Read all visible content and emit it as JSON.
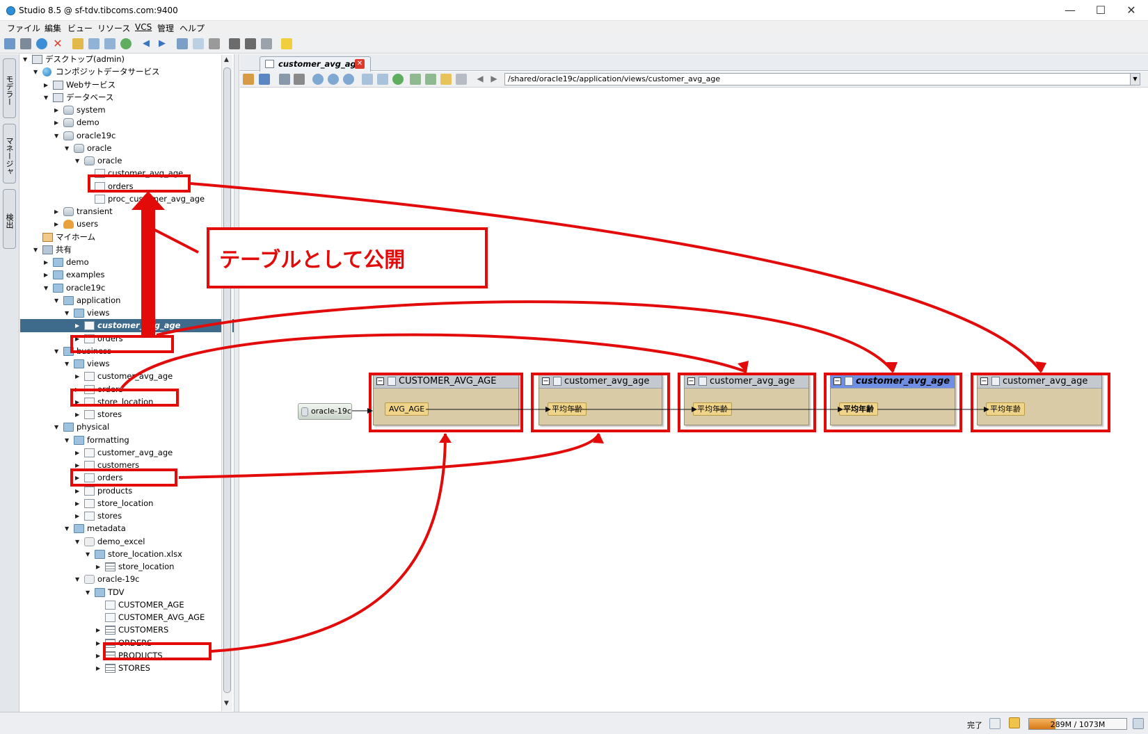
{
  "window": {
    "title": "Studio 8.5 @ sf-tdv.tibcoms.com:9400",
    "minimize": "—",
    "maximize": "☐",
    "close": "✕"
  },
  "menu": [
    "ファイル",
    "編集",
    "ビュー",
    "リソース",
    "VCS",
    "管理",
    "ヘルプ"
  ],
  "side_tabs": [
    "モデラー",
    "マネージャ",
    "検出"
  ],
  "tree": [
    {
      "label": "デスクトップ(admin)",
      "icon": "computer",
      "twisty": "▼"
    },
    {
      "label": "コンポジットデータサービス",
      "icon": "globe",
      "twisty": "▼"
    },
    {
      "label": "Webサービス",
      "icon": "composite",
      "twisty": "▶"
    },
    {
      "label": "データベース",
      "icon": "composite",
      "twisty": "▼"
    },
    {
      "label": "system",
      "icon": "db",
      "twisty": "▶"
    },
    {
      "label": "demo",
      "icon": "db",
      "twisty": "▶"
    },
    {
      "label": "oracle19c",
      "icon": "db",
      "twisty": "▼"
    },
    {
      "label": "oracle",
      "icon": "db",
      "twisty": "▼"
    },
    {
      "label": "oracle",
      "icon": "db",
      "twisty": "▼"
    },
    {
      "label": "customer_avg_age",
      "icon": "view",
      "twisty": ""
    },
    {
      "label": "orders",
      "icon": "view",
      "twisty": ""
    },
    {
      "label": "proc_customer_avg_age",
      "icon": "view",
      "twisty": ""
    },
    {
      "label": "transient",
      "icon": "db",
      "twisty": "▶"
    },
    {
      "label": "users",
      "icon": "users",
      "twisty": "▶"
    },
    {
      "label": "マイホーム",
      "icon": "home",
      "twisty": ""
    },
    {
      "label": "共有",
      "icon": "shared",
      "twisty": "▼"
    },
    {
      "label": "demo",
      "icon": "folder",
      "twisty": "▶"
    },
    {
      "label": "examples",
      "icon": "folder",
      "twisty": "▶"
    },
    {
      "label": "oracle19c",
      "icon": "folder",
      "twisty": "▼"
    },
    {
      "label": "application",
      "icon": "folder",
      "twisty": "▼"
    },
    {
      "label": "views",
      "icon": "folder",
      "twisty": "▼"
    },
    {
      "label": "customer_avg_age",
      "icon": "view",
      "twisty": "▶",
      "selected": true
    },
    {
      "label": "orders",
      "icon": "view",
      "twisty": "▶"
    },
    {
      "label": "business",
      "icon": "folder",
      "twisty": "▼"
    },
    {
      "label": "views",
      "icon": "folder",
      "twisty": "▼"
    },
    {
      "label": "customer_avg_age",
      "icon": "view",
      "twisty": "▶"
    },
    {
      "label": "orders",
      "icon": "view",
      "twisty": "▶"
    },
    {
      "label": "store_location",
      "icon": "view",
      "twisty": "▶"
    },
    {
      "label": "stores",
      "icon": "view",
      "twisty": "▶"
    },
    {
      "label": "physical",
      "icon": "folder",
      "twisty": "▼"
    },
    {
      "label": "formatting",
      "icon": "folder",
      "twisty": "▼"
    },
    {
      "label": "customer_avg_age",
      "icon": "view",
      "twisty": "▶"
    },
    {
      "label": "customers",
      "icon": "view",
      "twisty": "▶"
    },
    {
      "label": "orders",
      "icon": "view",
      "twisty": "▶"
    },
    {
      "label": "products",
      "icon": "view",
      "twisty": "▶"
    },
    {
      "label": "store_location",
      "icon": "view",
      "twisty": "▶"
    },
    {
      "label": "stores",
      "icon": "view",
      "twisty": "▶"
    },
    {
      "label": "metadata",
      "icon": "folder",
      "twisty": "▼"
    },
    {
      "label": "demo_excel",
      "icon": "dbfile",
      "twisty": "▼"
    },
    {
      "label": "store_location.xlsx",
      "icon": "folder",
      "twisty": "▼"
    },
    {
      "label": "store_location",
      "icon": "table",
      "twisty": "▶"
    },
    {
      "label": "oracle-19c",
      "icon": "dbfile",
      "twisty": "▼"
    },
    {
      "label": "TDV",
      "icon": "folder",
      "twisty": "▼"
    },
    {
      "label": "CUSTOMER_AGE",
      "icon": "view",
      "twisty": ""
    },
    {
      "label": "CUSTOMER_AVG_AGE",
      "icon": "view",
      "twisty": ""
    },
    {
      "label": "CUSTOMERS",
      "icon": "table",
      "twisty": "▶"
    },
    {
      "label": "ORDERS",
      "icon": "table",
      "twisty": "▶"
    },
    {
      "label": "PRODUCTS",
      "icon": "table",
      "twisty": "▶"
    },
    {
      "label": "STORES",
      "icon": "table",
      "twisty": "▶"
    }
  ],
  "editor": {
    "tab_title": "customer_avg_age",
    "tab_close": "✕",
    "path": "/shared/oracle19c/application/views/customer_avg_age",
    "path_dropdown": "▼"
  },
  "lineage": {
    "origin": "oracle-19c",
    "nodes": [
      {
        "title": "CUSTOMER_AVG_AGE",
        "field": "AVG_AGE",
        "highlighted": false
      },
      {
        "title": "customer_avg_age",
        "field": "平均年齢",
        "highlighted": false
      },
      {
        "title": "customer_avg_age",
        "field": "平均年齢",
        "highlighted": false
      },
      {
        "title": "customer_avg_age",
        "field": "平均年齢",
        "highlighted": true
      },
      {
        "title": "customer_avg_age",
        "field": "平均年齢",
        "highlighted": false
      }
    ],
    "collapse_symbol": "−"
  },
  "annotation": {
    "callout": "テーブルとして公開",
    "color": "#e30a0a"
  },
  "status": {
    "text": "完了",
    "memory": "289M / 1073M",
    "memory_used_fraction": 0.27
  },
  "colors": {
    "selection": "#3e6a8c",
    "node_body": "#d8cba6",
    "node_header": "#c4c9cf",
    "node_header_active": "#6f8fe4",
    "field": "#f0d48a"
  }
}
